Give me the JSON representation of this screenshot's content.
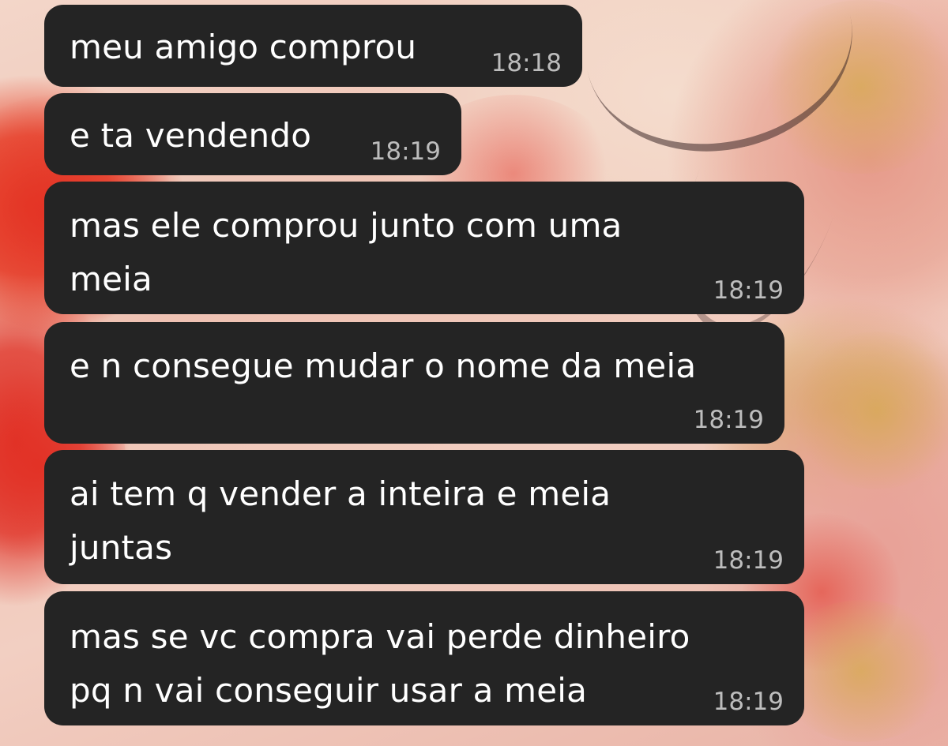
{
  "wallpaper": {
    "description_colors": {
      "red": "#e8432a",
      "pink": "#efc2b3",
      "gold": "#d4a75a"
    }
  },
  "bubble_color": "#242424",
  "messages": [
    {
      "text": "meu amigo comprou",
      "time": "18:18"
    },
    {
      "text": "e ta vendendo",
      "time": "18:19"
    },
    {
      "text": "mas ele comprou junto com uma\nmeia",
      "time": "18:19"
    },
    {
      "text": "e n consegue mudar o nome da meia",
      "time": "18:19"
    },
    {
      "text": "ai tem q vender a inteira e meia\njuntas",
      "time": "18:19"
    },
    {
      "text": "mas se vc compra vai perde dinheiro\npq n vai conseguir usar a meia",
      "time": "18:19"
    }
  ]
}
